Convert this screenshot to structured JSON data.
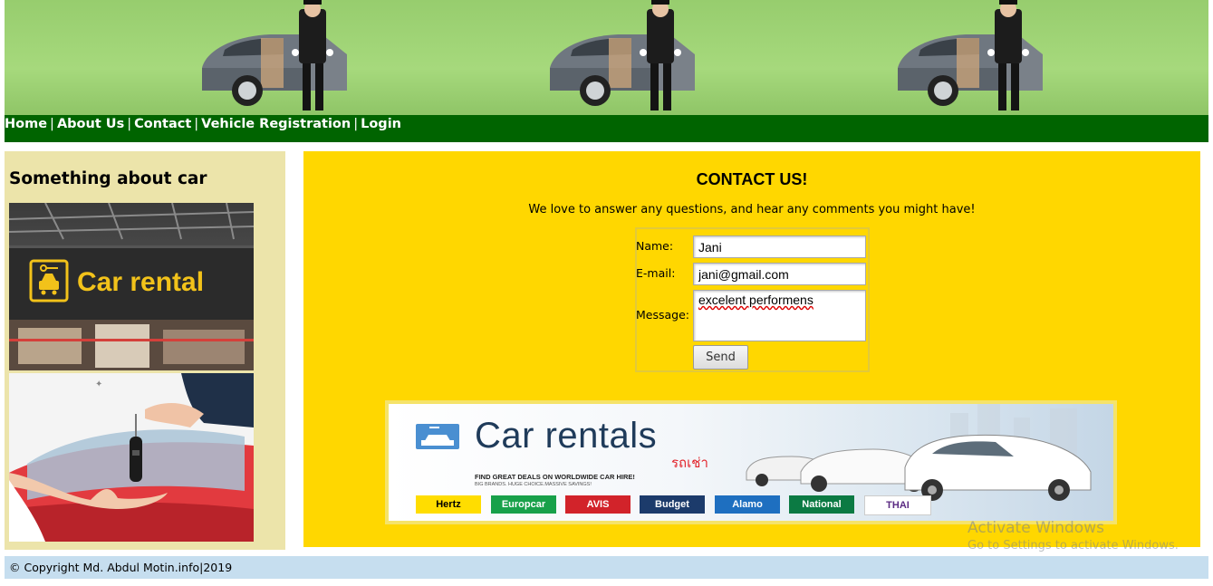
{
  "nav": {
    "items": [
      "Home",
      "About Us",
      "Contact",
      "Vehicle Registration",
      "Login"
    ],
    "separator": "|"
  },
  "sidebar": {
    "title": "Something about car",
    "sign_text": "Car rental"
  },
  "contact": {
    "title": "CONTACT US!",
    "intro": "We love to answer any questions, and hear any comments you might have!",
    "name_label": "Name:",
    "name_value": "Jani",
    "email_label": "E-mail:",
    "email_value": "jani@gmail.com",
    "message_label": "Message:",
    "message_value": "excelent performens",
    "send_label": "Send"
  },
  "promo": {
    "title": "Car rentals",
    "thai": "รถเช่า",
    "tagline": "FIND GREAT DEALS ON WORLDWIDE CAR HIRE!",
    "subtagline": "BIG BRANDS. HUGE CHOICE.MASSIVE SAVINGS!",
    "brands": [
      {
        "name": "Hertz",
        "bg": "#ffdd00",
        "fg": "#000000"
      },
      {
        "name": "Europcar",
        "bg": "#18a14a",
        "fg": "#ffffff"
      },
      {
        "name": "AVIS",
        "bg": "#d2232a",
        "fg": "#ffffff"
      },
      {
        "name": "Budget",
        "bg": "#1c3b6b",
        "fg": "#ffffff"
      },
      {
        "name": "Alamo",
        "bg": "#1e6fc0",
        "fg": "#ffffff"
      },
      {
        "name": "National",
        "bg": "#0b7a43",
        "fg": "#ffffff"
      },
      {
        "name": "THAI",
        "bg": "#ffffff",
        "fg": "#5a2a82"
      }
    ]
  },
  "footer": {
    "text": "© Copyright Md. Abdul Motin.info|2019"
  },
  "watermark": {
    "line1": "Activate Windows",
    "line2": "Go to Settings to activate Windows."
  },
  "colors": {
    "nav_bg": "#006400",
    "banner_green": "#a6d97c",
    "sidebar_bg": "#ece4aa",
    "content_bg": "#ffd700",
    "footer_bg": "#c6deef"
  }
}
